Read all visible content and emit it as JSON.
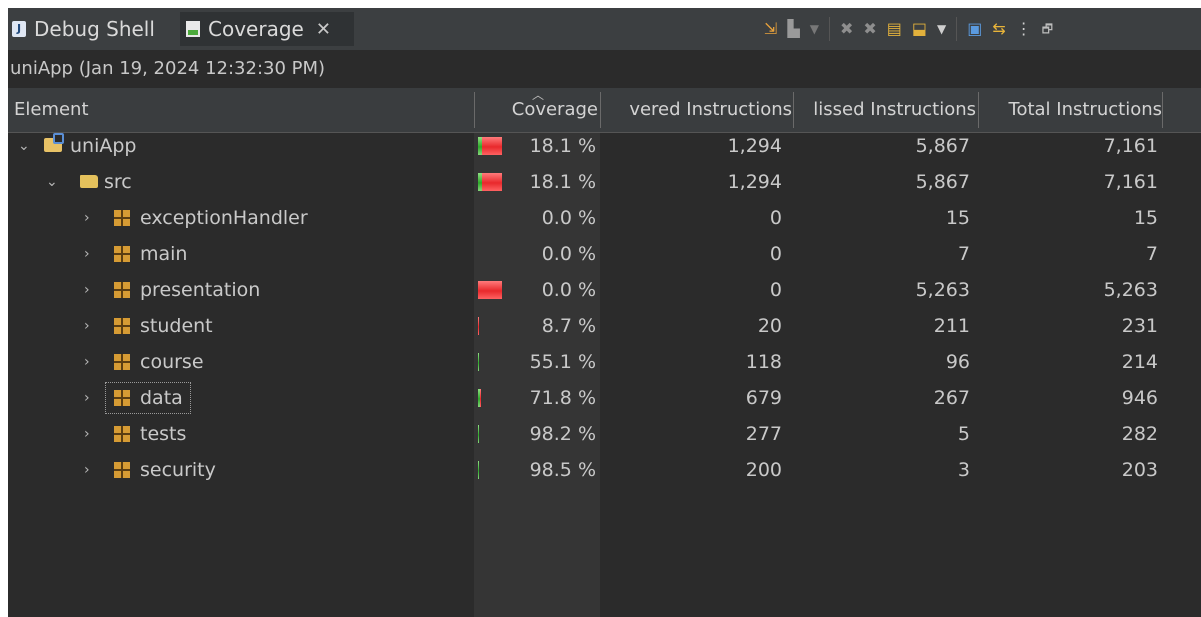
{
  "tabs": [
    {
      "label": "Debug Shell",
      "icon": "debug-shell-icon"
    },
    {
      "label": "Coverage",
      "icon": "coverage-icon",
      "active": true
    }
  ],
  "session": "uniApp (Jan 19, 2024 12:32:30 PM)",
  "columns": {
    "element": "Element",
    "coverage": "Coverage",
    "covered": "vered Instructions",
    "missed": "lissed Instructions",
    "total": "Total Instructions"
  },
  "rows": [
    {
      "name": "uniApp",
      "icon": "project-icon",
      "expanded": true,
      "coverage": "18.1 %",
      "covered": "1,294",
      "missed": "5,867",
      "total": "7,161",
      "covered_ratio": 0.181,
      "bar_full": true
    },
    {
      "name": "src",
      "icon": "folder-icon",
      "expanded": true,
      "coverage": "18.1 %",
      "covered": "1,294",
      "missed": "5,867",
      "total": "7,161",
      "covered_ratio": 0.181,
      "bar_full": true
    },
    {
      "name": "exceptionHandler",
      "icon": "package-icon",
      "coverage": "0.0 %",
      "covered": "0",
      "missed": "15",
      "total": "15",
      "covered_ratio": 0.0
    },
    {
      "name": "main",
      "icon": "package-icon",
      "coverage": "0.0 %",
      "covered": "0",
      "missed": "7",
      "total": "7",
      "covered_ratio": 0.0
    },
    {
      "name": "presentation",
      "icon": "package-icon",
      "coverage": "0.0 %",
      "covered": "0",
      "missed": "5,263",
      "total": "5,263",
      "covered_ratio": 0.0,
      "bar_full": true
    },
    {
      "name": "student",
      "icon": "package-icon",
      "coverage": "8.7 %",
      "covered": "20",
      "missed": "211",
      "total": "231",
      "covered_ratio": 0.087
    },
    {
      "name": "course",
      "icon": "package-icon",
      "coverage": "55.1 %",
      "covered": "118",
      "missed": "96",
      "total": "214",
      "covered_ratio": 0.551
    },
    {
      "name": "data",
      "icon": "package-icon",
      "coverage": "71.8 %",
      "covered": "679",
      "missed": "267",
      "total": "946",
      "covered_ratio": 0.718,
      "focused": true
    },
    {
      "name": "tests",
      "icon": "package-icon",
      "coverage": "98.2 %",
      "covered": "277",
      "missed": "5",
      "total": "282",
      "covered_ratio": 0.982
    },
    {
      "name": "security",
      "icon": "package-icon",
      "coverage": "98.5 %",
      "covered": "200",
      "missed": "3",
      "total": "203",
      "covered_ratio": 0.985
    }
  ],
  "colors": {
    "background": "#2b2b2b",
    "header": "#3a3d3f",
    "covered_bar": "#2eaa2b",
    "missed_bar": "#e8292c"
  }
}
